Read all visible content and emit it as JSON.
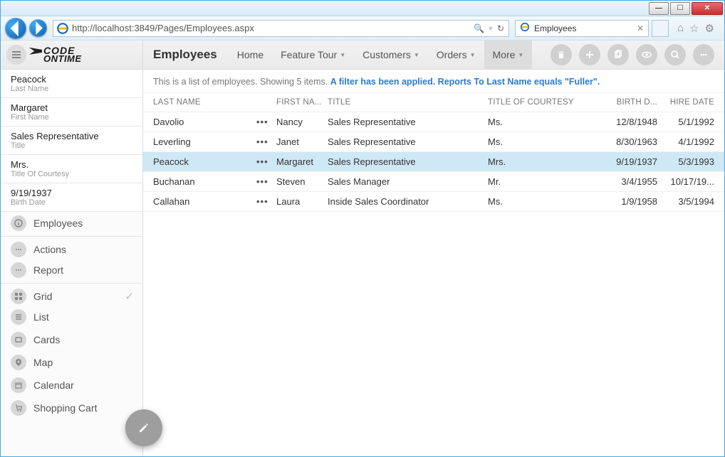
{
  "browser": {
    "url": "http://localhost:3849/Pages/Employees.aspx",
    "tab_title": "Employees"
  },
  "app": {
    "logo_line1": "CODE",
    "logo_line2": "ONTIME",
    "title": "Employees",
    "menu": {
      "home": "Home",
      "feature": "Feature Tour",
      "customers": "Customers",
      "orders": "Orders",
      "more": "More"
    },
    "info_prefix": "This is a list of employees. Showing 5 items. ",
    "info_filter": "A filter has been applied. Reports To Last Name equals \"Fuller\"."
  },
  "sidebar": {
    "details": [
      {
        "value": "Peacock",
        "label": "Last Name"
      },
      {
        "value": "Margaret",
        "label": "First Name"
      },
      {
        "value": "Sales Representative",
        "label": "Title"
      },
      {
        "value": "Mrs.",
        "label": "Title Of Courtesy"
      },
      {
        "value": "9/19/1937",
        "label": "Birth Date"
      }
    ],
    "nav": {
      "employees": "Employees",
      "actions": "Actions",
      "report": "Report",
      "grid": "Grid",
      "list": "List",
      "cards": "Cards",
      "map": "Map",
      "calendar": "Calendar",
      "cart": "Shopping Cart"
    }
  },
  "columns": {
    "last": "LAST NAME",
    "first": "FIRST NA...",
    "title": "TITLE",
    "toc": "TITLE OF COURTESY",
    "birth": "BIRTH D...",
    "hire": "HIRE DATE"
  },
  "rows": [
    {
      "last": "Davolio",
      "first": "Nancy",
      "title": "Sales Representative",
      "toc": "Ms.",
      "birth": "12/8/1948",
      "hire": "5/1/1992",
      "selected": false
    },
    {
      "last": "Leverling",
      "first": "Janet",
      "title": "Sales Representative",
      "toc": "Ms.",
      "birth": "8/30/1963",
      "hire": "4/1/1992",
      "selected": false
    },
    {
      "last": "Peacock",
      "first": "Margaret",
      "title": "Sales Representative",
      "toc": "Mrs.",
      "birth": "9/19/1937",
      "hire": "5/3/1993",
      "selected": true
    },
    {
      "last": "Buchanan",
      "first": "Steven",
      "title": "Sales Manager",
      "toc": "Mr.",
      "birth": "3/4/1955",
      "hire": "10/17/19...",
      "selected": false
    },
    {
      "last": "Callahan",
      "first": "Laura",
      "title": "Inside Sales Coordinator",
      "toc": "Ms.",
      "birth": "1/9/1958",
      "hire": "3/5/1994",
      "selected": false
    }
  ]
}
